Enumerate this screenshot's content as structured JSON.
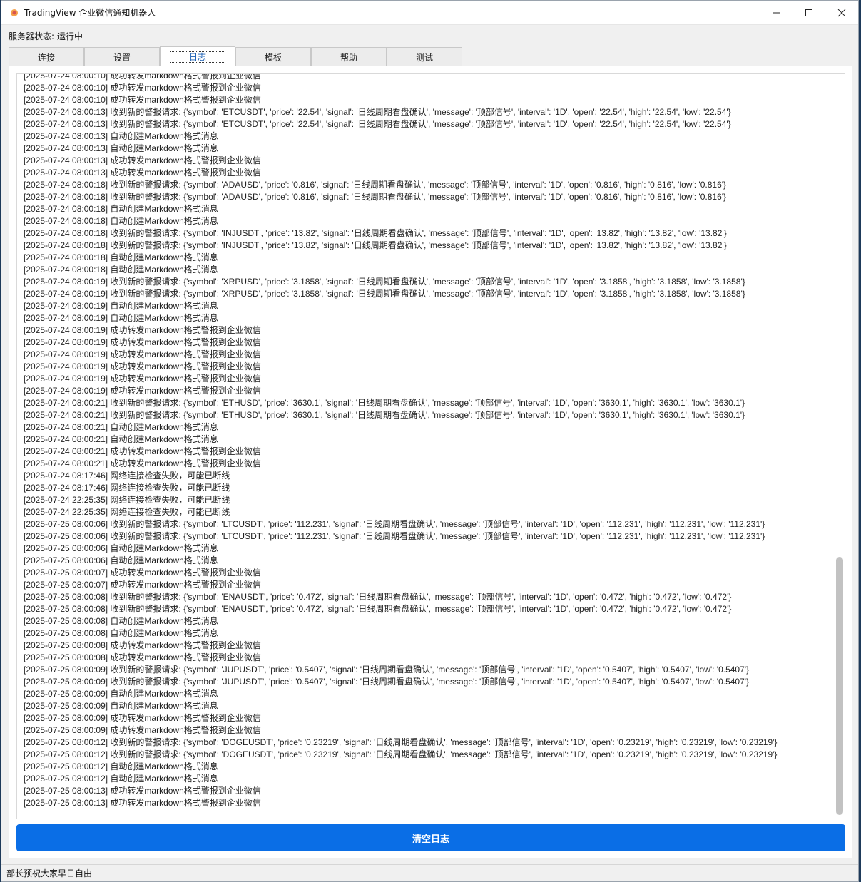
{
  "window": {
    "title": "TradingView 企业微信通知机器人",
    "minimize_icon": "minimize-icon",
    "maximize_icon": "maximize-icon",
    "close_icon": "close-icon"
  },
  "server_status": {
    "label": "服务器状态:",
    "value": "运行中"
  },
  "tabs": [
    {
      "label": "连接"
    },
    {
      "label": "设置"
    },
    {
      "label": "日志",
      "active": true
    },
    {
      "label": "模板"
    },
    {
      "label": "帮助"
    },
    {
      "label": "测试"
    }
  ],
  "log": {
    "lines": [
      "[2025-07-24 08:00:10] 成功转发markdown格式警报到企业微信",
      "[2025-07-24 08:00:10] 成功转发markdown格式警报到企业微信",
      "[2025-07-24 08:00:10] 成功转发markdown格式警报到企业微信",
      "[2025-07-24 08:00:13] 收到新的警报请求: {'symbol': 'ETCUSDT', 'price': '22.54', 'signal': '日线周期看盘确认', 'message': '顶部信号', 'interval': '1D', 'open': '22.54', 'high': '22.54', 'low': '22.54'}",
      "[2025-07-24 08:00:13] 收到新的警报请求: {'symbol': 'ETCUSDT', 'price': '22.54', 'signal': '日线周期看盘确认', 'message': '顶部信号', 'interval': '1D', 'open': '22.54', 'high': '22.54', 'low': '22.54'}",
      "[2025-07-24 08:00:13] 自动创建Markdown格式消息",
      "[2025-07-24 08:00:13] 自动创建Markdown格式消息",
      "[2025-07-24 08:00:13] 成功转发markdown格式警报到企业微信",
      "[2025-07-24 08:00:13] 成功转发markdown格式警报到企业微信",
      "[2025-07-24 08:00:18] 收到新的警报请求: {'symbol': 'ADAUSD', 'price': '0.816', 'signal': '日线周期看盘确认', 'message': '顶部信号', 'interval': '1D', 'open': '0.816', 'high': '0.816', 'low': '0.816'}",
      "[2025-07-24 08:00:18] 收到新的警报请求: {'symbol': 'ADAUSD', 'price': '0.816', 'signal': '日线周期看盘确认', 'message': '顶部信号', 'interval': '1D', 'open': '0.816', 'high': '0.816', 'low': '0.816'}",
      "[2025-07-24 08:00:18] 自动创建Markdown格式消息",
      "[2025-07-24 08:00:18] 自动创建Markdown格式消息",
      "[2025-07-24 08:00:18] 收到新的警报请求: {'symbol': 'INJUSDT', 'price': '13.82', 'signal': '日线周期看盘确认', 'message': '顶部信号', 'interval': '1D', 'open': '13.82', 'high': '13.82', 'low': '13.82'}",
      "[2025-07-24 08:00:18] 收到新的警报请求: {'symbol': 'INJUSDT', 'price': '13.82', 'signal': '日线周期看盘确认', 'message': '顶部信号', 'interval': '1D', 'open': '13.82', 'high': '13.82', 'low': '13.82'}",
      "[2025-07-24 08:00:18] 自动创建Markdown格式消息",
      "[2025-07-24 08:00:18] 自动创建Markdown格式消息",
      "[2025-07-24 08:00:19] 收到新的警报请求: {'symbol': 'XRPUSD', 'price': '3.1858', 'signal': '日线周期看盘确认', 'message': '顶部信号', 'interval': '1D', 'open': '3.1858', 'high': '3.1858', 'low': '3.1858'}",
      "[2025-07-24 08:00:19] 收到新的警报请求: {'symbol': 'XRPUSD', 'price': '3.1858', 'signal': '日线周期看盘确认', 'message': '顶部信号', 'interval': '1D', 'open': '3.1858', 'high': '3.1858', 'low': '3.1858'}",
      "[2025-07-24 08:00:19] 自动创建Markdown格式消息",
      "[2025-07-24 08:00:19] 自动创建Markdown格式消息",
      "[2025-07-24 08:00:19] 成功转发markdown格式警报到企业微信",
      "[2025-07-24 08:00:19] 成功转发markdown格式警报到企业微信",
      "[2025-07-24 08:00:19] 成功转发markdown格式警报到企业微信",
      "[2025-07-24 08:00:19] 成功转发markdown格式警报到企业微信",
      "[2025-07-24 08:00:19] 成功转发markdown格式警报到企业微信",
      "[2025-07-24 08:00:19] 成功转发markdown格式警报到企业微信",
      "[2025-07-24 08:00:21] 收到新的警报请求: {'symbol': 'ETHUSD', 'price': '3630.1', 'signal': '日线周期看盘确认', 'message': '顶部信号', 'interval': '1D', 'open': '3630.1', 'high': '3630.1', 'low': '3630.1'}",
      "[2025-07-24 08:00:21] 收到新的警报请求: {'symbol': 'ETHUSD', 'price': '3630.1', 'signal': '日线周期看盘确认', 'message': '顶部信号', 'interval': '1D', 'open': '3630.1', 'high': '3630.1', 'low': '3630.1'}",
      "[2025-07-24 08:00:21] 自动创建Markdown格式消息",
      "[2025-07-24 08:00:21] 自动创建Markdown格式消息",
      "[2025-07-24 08:00:21] 成功转发markdown格式警报到企业微信",
      "[2025-07-24 08:00:21] 成功转发markdown格式警报到企业微信",
      "[2025-07-24 08:17:46] 网络连接检查失败，可能已断线",
      "[2025-07-24 08:17:46] 网络连接检查失败，可能已断线",
      "[2025-07-24 22:25:35] 网络连接检查失败，可能已断线",
      "[2025-07-24 22:25:35] 网络连接检查失败，可能已断线",
      "[2025-07-25 08:00:06] 收到新的警报请求: {'symbol': 'LTCUSDT', 'price': '112.231', 'signal': '日线周期看盘确认', 'message': '顶部信号', 'interval': '1D', 'open': '112.231', 'high': '112.231', 'low': '112.231'}",
      "[2025-07-25 08:00:06] 收到新的警报请求: {'symbol': 'LTCUSDT', 'price': '112.231', 'signal': '日线周期看盘确认', 'message': '顶部信号', 'interval': '1D', 'open': '112.231', 'high': '112.231', 'low': '112.231'}",
      "[2025-07-25 08:00:06] 自动创建Markdown格式消息",
      "[2025-07-25 08:00:06] 自动创建Markdown格式消息",
      "[2025-07-25 08:00:07] 成功转发markdown格式警报到企业微信",
      "[2025-07-25 08:00:07] 成功转发markdown格式警报到企业微信",
      "[2025-07-25 08:00:08] 收到新的警报请求: {'symbol': 'ENAUSDT', 'price': '0.472', 'signal': '日线周期看盘确认', 'message': '顶部信号', 'interval': '1D', 'open': '0.472', 'high': '0.472', 'low': '0.472'}",
      "[2025-07-25 08:00:08] 收到新的警报请求: {'symbol': 'ENAUSDT', 'price': '0.472', 'signal': '日线周期看盘确认', 'message': '顶部信号', 'interval': '1D', 'open': '0.472', 'high': '0.472', 'low': '0.472'}",
      "[2025-07-25 08:00:08] 自动创建Markdown格式消息",
      "[2025-07-25 08:00:08] 自动创建Markdown格式消息",
      "[2025-07-25 08:00:08] 成功转发markdown格式警报到企业微信",
      "[2025-07-25 08:00:08] 成功转发markdown格式警报到企业微信",
      "[2025-07-25 08:00:09] 收到新的警报请求: {'symbol': 'JUPUSDT', 'price': '0.5407', 'signal': '日线周期看盘确认', 'message': '顶部信号', 'interval': '1D', 'open': '0.5407', 'high': '0.5407', 'low': '0.5407'}",
      "[2025-07-25 08:00:09] 收到新的警报请求: {'symbol': 'JUPUSDT', 'price': '0.5407', 'signal': '日线周期看盘确认', 'message': '顶部信号', 'interval': '1D', 'open': '0.5407', 'high': '0.5407', 'low': '0.5407'}",
      "[2025-07-25 08:00:09] 自动创建Markdown格式消息",
      "[2025-07-25 08:00:09] 自动创建Markdown格式消息",
      "[2025-07-25 08:00:09] 成功转发markdown格式警报到企业微信",
      "[2025-07-25 08:00:09] 成功转发markdown格式警报到企业微信",
      "[2025-07-25 08:00:12] 收到新的警报请求: {'symbol': 'DOGEUSDT', 'price': '0.23219', 'signal': '日线周期看盘确认', 'message': '顶部信号', 'interval': '1D', 'open': '0.23219', 'high': '0.23219', 'low': '0.23219'}",
      "[2025-07-25 08:00:12] 收到新的警报请求: {'symbol': 'DOGEUSDT', 'price': '0.23219', 'signal': '日线周期看盘确认', 'message': '顶部信号', 'interval': '1D', 'open': '0.23219', 'high': '0.23219', 'low': '0.23219'}",
      "[2025-07-25 08:00:12] 自动创建Markdown格式消息",
      "[2025-07-25 08:00:12] 自动创建Markdown格式消息",
      "[2025-07-25 08:00:13] 成功转发markdown格式警报到企业微信",
      "[2025-07-25 08:00:13] 成功转发markdown格式警报到企业微信"
    ]
  },
  "clear_button": {
    "label": "清空日志"
  },
  "statusbar": {
    "text": "部长预祝大家早日自由"
  },
  "colors": {
    "accent": "#0a6ee6",
    "active_tab_text": "#1a5fb4"
  }
}
